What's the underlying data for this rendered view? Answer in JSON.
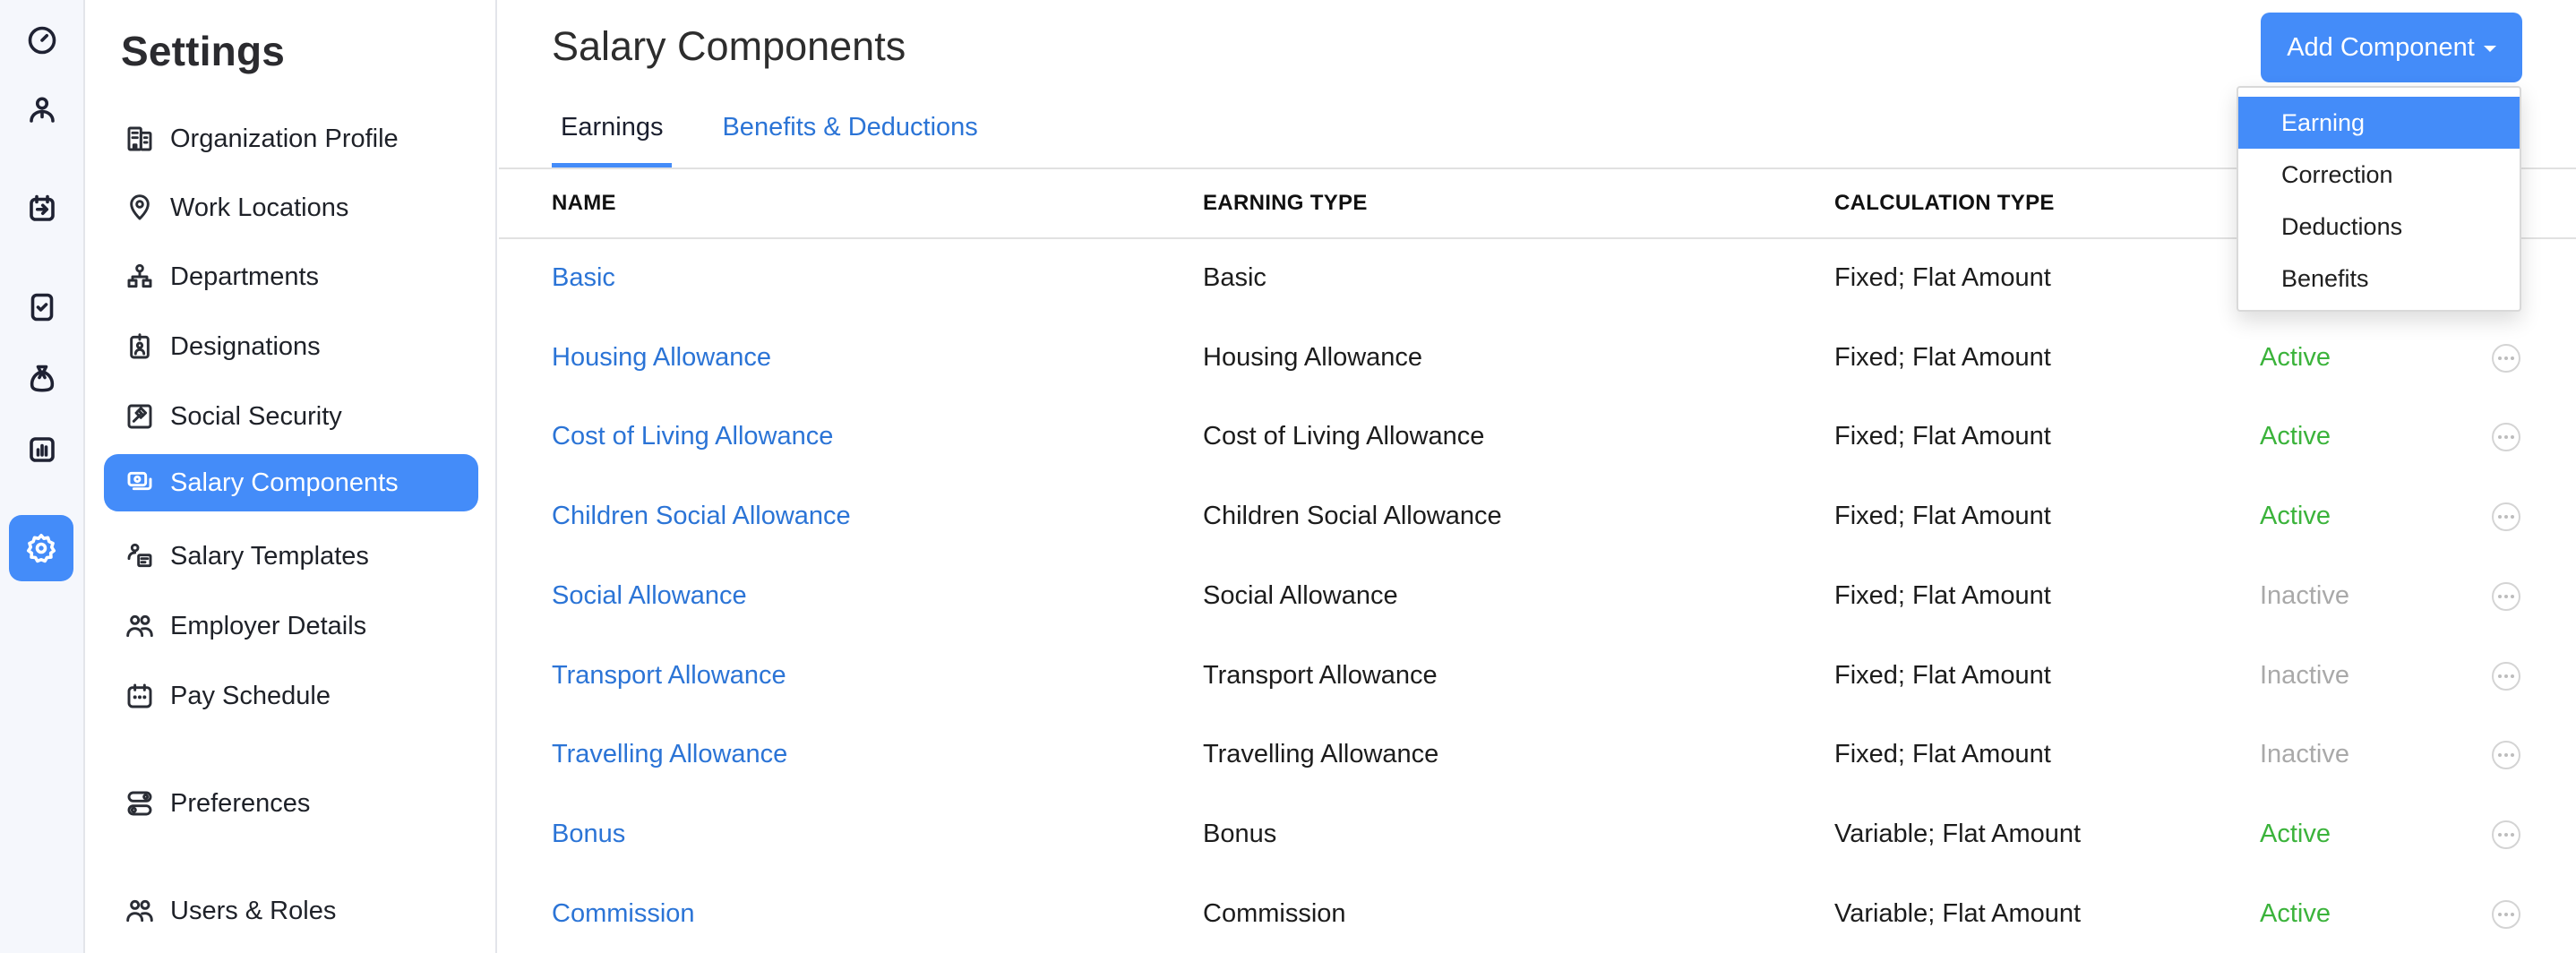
{
  "rail": {
    "items": [
      {
        "icon": "dashboard-gauge-icon"
      },
      {
        "icon": "employee-person-icon"
      },
      {
        "icon": "calendar-arrow-icon"
      },
      {
        "icon": "approvals-checklist-icon"
      },
      {
        "icon": "money-bag-icon"
      },
      {
        "icon": "reports-chart-icon"
      },
      {
        "icon": "settings-gear-icon",
        "active": true
      }
    ]
  },
  "sidebar": {
    "title": "Settings",
    "items": [
      {
        "label": "Organization Profile",
        "icon": "building-icon"
      },
      {
        "label": "Work Locations",
        "icon": "location-pin-icon"
      },
      {
        "label": "Departments",
        "icon": "org-chart-icon"
      },
      {
        "label": "Designations",
        "icon": "id-badge-icon"
      },
      {
        "label": "Social Security",
        "icon": "gavel-icon"
      },
      {
        "label": "Salary Components",
        "icon": "money-cards-icon",
        "active": true
      },
      {
        "label": "Salary Templates",
        "icon": "person-template-icon"
      },
      {
        "label": "Employer Details",
        "icon": "people-icon"
      },
      {
        "label": "Pay Schedule",
        "icon": "calendar-dots-icon"
      },
      {
        "label": "Preferences",
        "icon": "toggles-icon"
      },
      {
        "label": "Users & Roles",
        "icon": "users-icon"
      }
    ]
  },
  "header": {
    "title": "Salary Components",
    "add_button_label": "Add Component"
  },
  "tabs": [
    {
      "label": "Earnings",
      "active": true
    },
    {
      "label": "Benefits & Deductions",
      "active": false
    }
  ],
  "dropdown": {
    "items": [
      "Earning",
      "Correction",
      "Deductions",
      "Benefits"
    ],
    "highlighted": "Earning"
  },
  "table": {
    "columns": [
      "NAME",
      "EARNING TYPE",
      "CALCULATION TYPE"
    ],
    "rows": [
      {
        "name": "Basic",
        "earning_type": "Basic",
        "calculation_type": "Fixed; Flat Amount",
        "status": ""
      },
      {
        "name": "Housing Allowance",
        "earning_type": "Housing Allowance",
        "calculation_type": "Fixed; Flat Amount",
        "status": "Active"
      },
      {
        "name": "Cost of Living Allowance",
        "earning_type": "Cost of Living Allowance",
        "calculation_type": "Fixed; Flat Amount",
        "status": "Active"
      },
      {
        "name": "Children Social Allowance",
        "earning_type": "Children Social Allowance",
        "calculation_type": "Fixed; Flat Amount",
        "status": "Active"
      },
      {
        "name": "Social Allowance",
        "earning_type": "Social Allowance",
        "calculation_type": "Fixed; Flat Amount",
        "status": "Inactive"
      },
      {
        "name": "Transport Allowance",
        "earning_type": "Transport Allowance",
        "calculation_type": "Fixed; Flat Amount",
        "status": "Inactive"
      },
      {
        "name": "Travelling Allowance",
        "earning_type": "Travelling Allowance",
        "calculation_type": "Fixed; Flat Amount",
        "status": "Inactive"
      },
      {
        "name": "Bonus",
        "earning_type": "Bonus",
        "calculation_type": "Variable; Flat Amount",
        "status": "Active"
      },
      {
        "name": "Commission",
        "earning_type": "Commission",
        "calculation_type": "Variable; Flat Amount",
        "status": "Active"
      }
    ]
  },
  "colors": {
    "accent": "#448cf9",
    "link": "#2b74d6",
    "status_active": "#3bb33b",
    "status_inactive": "#a9a9a9"
  }
}
